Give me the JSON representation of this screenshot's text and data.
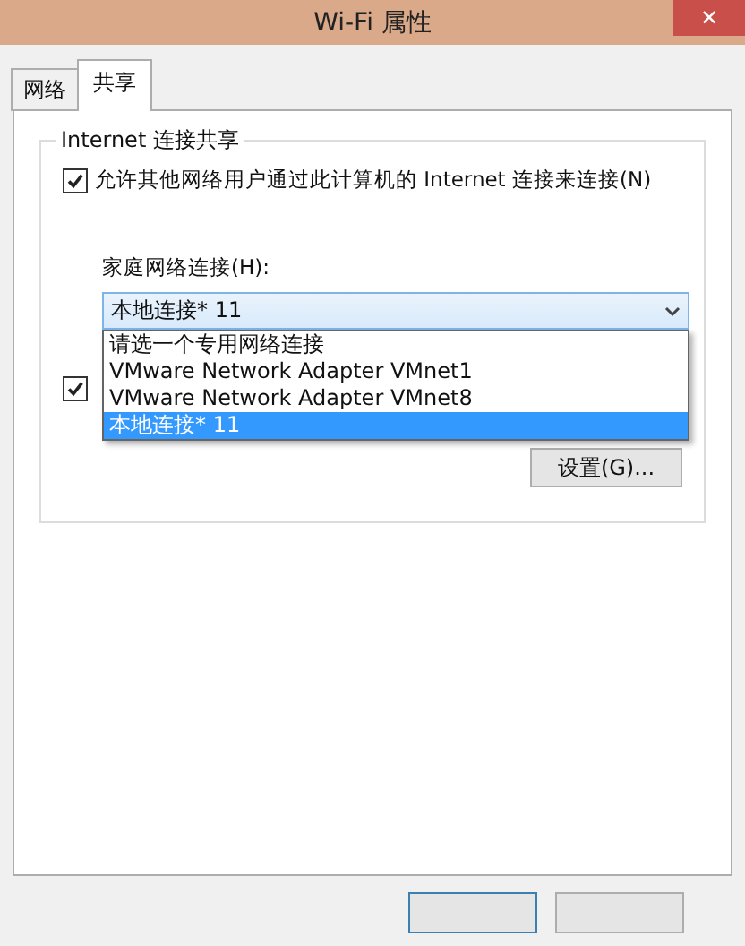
{
  "window": {
    "title": "Wi-Fi 属性",
    "close": "✕"
  },
  "tabs": [
    {
      "label": "网络",
      "selected": false
    },
    {
      "label": "共享",
      "selected": true
    }
  ],
  "group": {
    "title": "Internet 连接共享",
    "allow_sharing": {
      "label": "允许其他网络用户通过此计算机的 Internet 连接来连接(N)",
      "checked": true
    },
    "home_network": {
      "label": "家庭网络连接(H):",
      "value": "本地连接* 11",
      "expanded": true,
      "options": [
        {
          "label": "请选一个专用网络连接",
          "selected": false
        },
        {
          "label": "VMware Network Adapter VMnet1",
          "selected": false
        },
        {
          "label": "VMware Network Adapter VMnet8",
          "selected": false
        },
        {
          "label": "本地连接* 11",
          "selected": true
        }
      ]
    },
    "allow_control": {
      "checked": true
    },
    "settings_button": "设置(G)..."
  },
  "footer_buttons": [
    {
      "kind": "default"
    },
    {
      "kind": "normal"
    }
  ]
}
